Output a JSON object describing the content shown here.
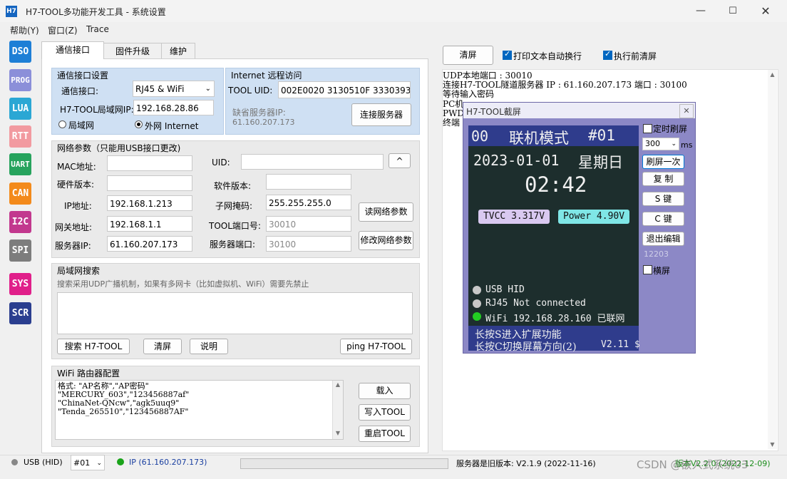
{
  "window": {
    "title": "H7-TOOL多功能开发工具 - 系统设置",
    "icon_text": "H7"
  },
  "menu": [
    "帮助(Y)",
    "窗口(Z)",
    "Trace"
  ],
  "sidebar": [
    {
      "label": "DSO",
      "color": "#1e7fd6"
    },
    {
      "label": "PROG",
      "color": "#8b8fd9"
    },
    {
      "label": "LUA",
      "color": "#2ba7d4"
    },
    {
      "label": "RTT",
      "color": "#f29aa0"
    },
    {
      "label": "UART",
      "color": "#27a35d"
    },
    {
      "label": "CAN",
      "color": "#f38a1b"
    },
    {
      "label": "I2C",
      "color": "#c2388e"
    },
    {
      "label": "SPI",
      "color": "#7d7d7d"
    },
    {
      "label": "SYS",
      "color": "#e01f8a"
    },
    {
      "label": "SCR",
      "color": "#2a3e8f"
    }
  ],
  "tabs": [
    "通信接口",
    "固件升级",
    "维护"
  ],
  "comm": {
    "group_title": "通信接口设置",
    "iface_label": "通信接口:",
    "iface_value": "RJ45 & WiFi",
    "lan_ip_label": "H7-TOOL局域网IP:",
    "lan_ip_value": "192.168.28.86",
    "radio_lan": "局域网",
    "radio_wan": "外网 Internet"
  },
  "internet": {
    "group_title": "Internet 远程访问",
    "uid_label": "TOOL UID:",
    "uid_value": "002E0020 3130510F 33303938",
    "default_server_label": "缺省服务器IP:",
    "default_server_value": "61.160.207.173",
    "connect_button": "连接服务器"
  },
  "net": {
    "group_title": "网络参数（只能用USB接口更改)",
    "mac_label": "MAC地址:",
    "uid_label": "UID:",
    "up_button": "^",
    "hw_label": "硬件版本:",
    "sw_label": "软件版本:",
    "ip_label": "IP地址:",
    "ip_value": "192.168.1.213",
    "mask_label": "子网掩码:",
    "mask_value": "255.255.255.0",
    "read_button": "读网络参数",
    "gw_label": "网关地址:",
    "gw_value": "192.168.1.1",
    "port_label": "TOOL端口号:",
    "port_value": "30010",
    "server_label": "服务器IP:",
    "server_value": "61.160.207.173",
    "server_port_label": "服务器端口:",
    "server_port_value": "30100",
    "modify_button": "修改网络参数"
  },
  "lan_search": {
    "group_title": "局域网搜索",
    "hint": "搜索采用UDP广播机制，如果有多网卡（比如虚拟机、WiFi）需要先禁止",
    "search_button": "搜索 H7-TOOL",
    "clear_button": "清屏",
    "help_button": "说明",
    "ping_button": "ping H7-TOOL"
  },
  "wifi": {
    "group_title": "WiFi 路由器配置",
    "lines": [
      "格式: \"AP名称\",\"AP密码\"",
      "\"MERCURY_603\",\"123456887af\"",
      "\"ChinaNet-QNcw\",\"agk5uuq9\"",
      "\"Tenda_265510\",\"123456887AF\""
    ],
    "load_button": "载入",
    "write_button": "写入TOOL",
    "restart_button": "重启TOOL"
  },
  "right": {
    "clear_button": "清屏",
    "wrap_label": "打印文本自动换行",
    "clear_before_label": "执行前清屏",
    "log_lines": [
      "UDP本地端口 : 30010",
      "连接H7-TOOL隧道服务器 IP : 61.160.207.173 端口 : 30100",
      "等待输入密码",
      "PC机",
      "PWD=",
      "终端"
    ]
  },
  "screenshot_window": {
    "title": "H7-TOOL截屏",
    "close_icon": "close-icon",
    "header_left": "00",
    "header_title": "联机模式",
    "header_right": "#01",
    "date": "2023-01-01",
    "weekday": "星期日",
    "time": "02:42",
    "tvcc": "TVCC 3.317V",
    "power": "Power 4.90V",
    "usb": "USB HID",
    "rj45": "RJ45 Not connected",
    "wifi": "WiFi 192.168.28.160 已联网",
    "hint1": "长按S进入扩展功能",
    "hint2": "长按C切换屏幕方向(2)",
    "version": "V2.11 $",
    "timer_label": "定时刷屏",
    "interval_value": "300",
    "interval_unit": "ms",
    "refresh_button": "刷屏一次",
    "copy_button": "复 制",
    "s_button": "S 键",
    "c_button": "C 键",
    "exit_edit_button": "退出编辑",
    "counter": "12203",
    "landscape_label": "横屏",
    "colors": {
      "usb_dot": "#c8c8c8",
      "rj45_dot": "#c8c8c8",
      "wifi_dot": "#22cc22",
      "tvcc_bg": "#d9c9f0",
      "power_bg": "#7fe6e6"
    }
  },
  "status": {
    "usb": "USB (HID)",
    "device": "#01",
    "ip": "IP (61.160.207.173)",
    "server_version": "服务器是旧版本: V2.1.9 (2022-11-16)",
    "local_version": "版本V2.2.0 (2022-12-09)",
    "watermark": "CSDN @嵌入式系统03",
    "colors": {
      "usb_dot": "#888888",
      "ip_dot": "#1aa31a"
    }
  }
}
